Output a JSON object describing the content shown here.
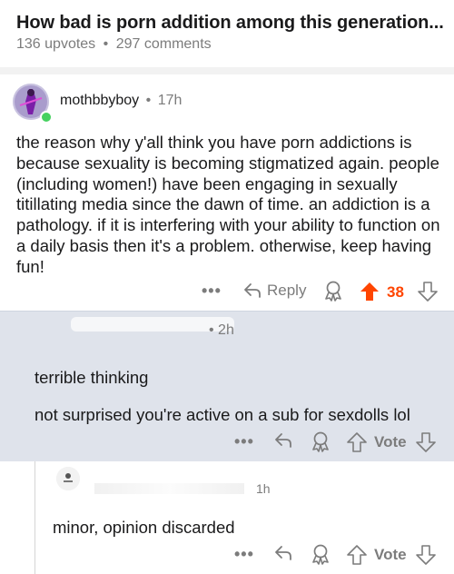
{
  "post": {
    "title": "How bad is porn addition among this generation...",
    "upvotes": "136 upvotes",
    "separator": "•",
    "comments": "297 comments"
  },
  "comment1": {
    "username": "mothbbyboy",
    "separator": "•",
    "time": "17h",
    "body": "the reason why y'all think you have porn addictions is because sexuality is becoming stigmatized again. people (including women!) have been engaging in sexually titillating media since the dawn of time. an addiction is a pathology. if it is interfering with your ability to function on a daily basis then it's a problem. otherwise, keep having fun!",
    "more": "•••",
    "reply_label": "Reply",
    "score": "38",
    "accent": "#ff4500"
  },
  "comment2": {
    "time": "• 2h",
    "line1": "terrible thinking",
    "line2": "not surprised you're active on a sub for sexdolls lol",
    "more": "•••",
    "vote_label": "Vote"
  },
  "comment3": {
    "time": "1h",
    "body": "minor, opinion discarded",
    "more": "•••",
    "vote_label": "Vote"
  },
  "icons": [
    "reply-icon",
    "award-icon",
    "upvote-icon",
    "downvote-icon",
    "online-indicator-icon"
  ]
}
